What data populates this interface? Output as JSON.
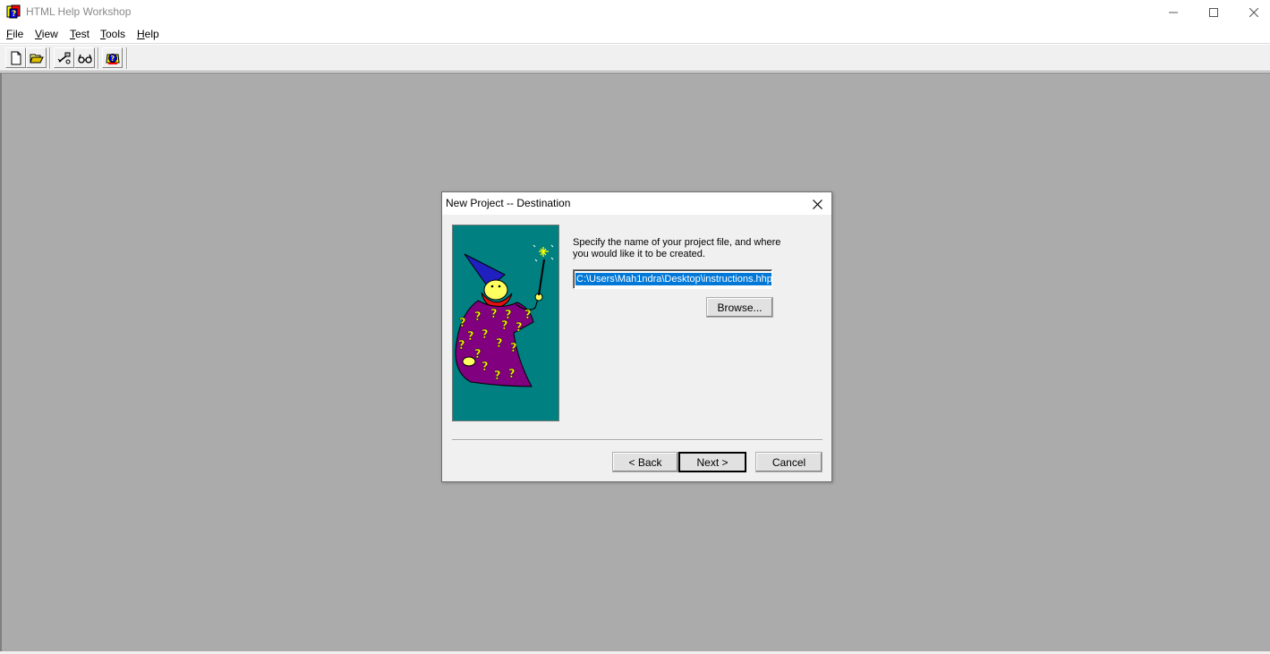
{
  "window": {
    "title": "HTML Help Workshop",
    "controls": {
      "minimize": "minimize-icon",
      "maximize": "maximize-icon",
      "close": "close-icon"
    }
  },
  "menu": [
    {
      "label": "File",
      "accel": "F",
      "rest": "ile"
    },
    {
      "label": "View",
      "accel": "V",
      "rest": "iew"
    },
    {
      "label": "Test",
      "accel": "T",
      "rest": "est"
    },
    {
      "label": "Tools",
      "accel": "T",
      "rest": "ools"
    },
    {
      "label": "Help",
      "accel": "H",
      "rest": "elp"
    }
  ],
  "toolbar": {
    "buttons": [
      "new-file-icon",
      "open-folder-icon",
      "compile-icon",
      "view-compiled-icon",
      "help-icon"
    ]
  },
  "dialog": {
    "title": "New Project -- Destination",
    "prompt": "Specify the name of your project file, and where you would like it to be created.",
    "path_value": "C:\\Users\\Mah1ndra\\Desktop\\instructions.hhp",
    "browse_label": "Browse...",
    "back_label": "< Back",
    "next_label": "Next >",
    "cancel_label": "Cancel",
    "art": "wizard-illustration"
  },
  "colors": {
    "workspace": "#ababab",
    "wizard_bg": "#008080",
    "robe": "#800080",
    "question_marks": "#ffff00",
    "selection": "#0078d7"
  }
}
